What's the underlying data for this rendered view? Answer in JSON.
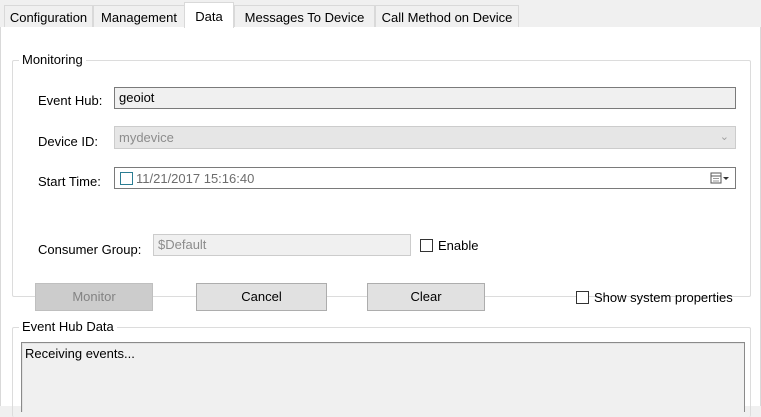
{
  "tabs": [
    {
      "label": "Configuration"
    },
    {
      "label": "Management"
    },
    {
      "label": "Data",
      "active": true
    },
    {
      "label": "Messages To Device"
    },
    {
      "label": "Call Method on Device"
    }
  ],
  "monitoring": {
    "title": "Monitoring",
    "event_hub": {
      "label": "Event Hub:",
      "value": "geoiot"
    },
    "device_id": {
      "label": "Device ID:",
      "value": "mydevice"
    },
    "start_time": {
      "label": "Start Time:",
      "value": "11/21/2017 15:16:40"
    },
    "consumer_group": {
      "label": "Consumer Group:",
      "value": "$Default"
    },
    "enable_checkbox": {
      "label": "Enable",
      "checked": false
    },
    "buttons": {
      "monitor": "Monitor",
      "cancel": "Cancel",
      "clear": "Clear"
    },
    "show_system_properties": {
      "label": "Show system properties",
      "checked": false
    }
  },
  "event_hub_data": {
    "title": "Event Hub Data",
    "output": "Receiving events..."
  },
  "colors": {
    "panel": "#ffffff",
    "window": "#f0f0f0",
    "disabled_button": "#cccccc"
  }
}
